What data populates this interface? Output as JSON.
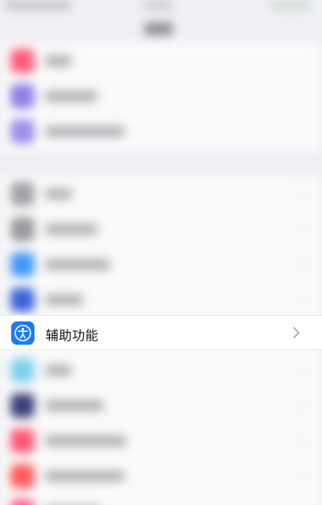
{
  "accessibility_row": {
    "label": "辅助功能",
    "icon": "accessibility-icon",
    "chevron": "chevron-right-icon"
  },
  "colors": {
    "accent": "#1a7cf5",
    "background": "#efeff4",
    "row_bg": "#ffffff"
  }
}
